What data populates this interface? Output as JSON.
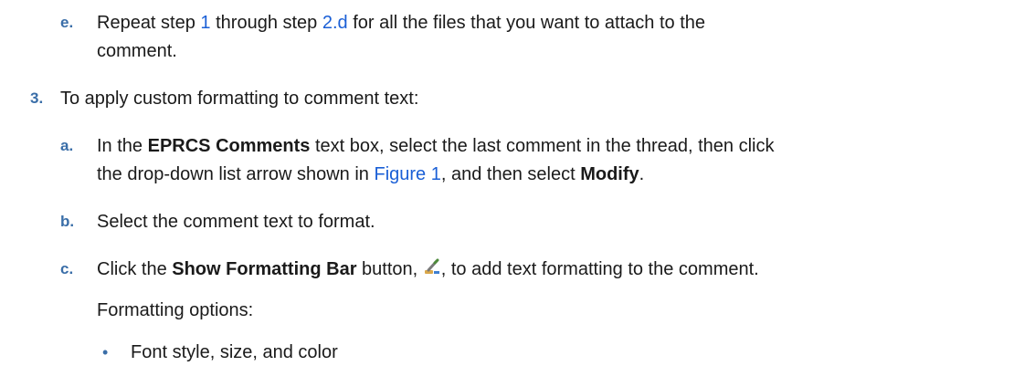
{
  "item_e": {
    "marker": "e.",
    "t1": "Repeat step ",
    "link1": "1",
    "t2": " through step ",
    "link2": "2.d",
    "t3": " for all the files that you want to attach to the",
    "line2": "comment."
  },
  "step3": {
    "marker": "3.",
    "text": "To apply custom formatting to comment text:"
  },
  "item_a": {
    "marker": "a.",
    "t1": "In the ",
    "b1": "EPRCS Comments",
    "t2": " text box, select the last comment in the thread, then click",
    "t3": "the drop-down list arrow shown in ",
    "link": "Figure 1",
    "t4": ", and then select ",
    "b2": "Modify",
    "t5": "."
  },
  "item_b": {
    "marker": "b.",
    "text": "Select the comment text to format."
  },
  "item_c": {
    "marker": "c.",
    "t1": "Click the ",
    "b1": "Show Formatting Bar",
    "t2": " button, ",
    "icon": "formatting-bar-icon",
    "t3": ", to add text formatting to the comment."
  },
  "formatting_options_label": "Formatting options:",
  "bullets": [
    {
      "marker": "•",
      "text": "Font style, size, and color"
    }
  ]
}
